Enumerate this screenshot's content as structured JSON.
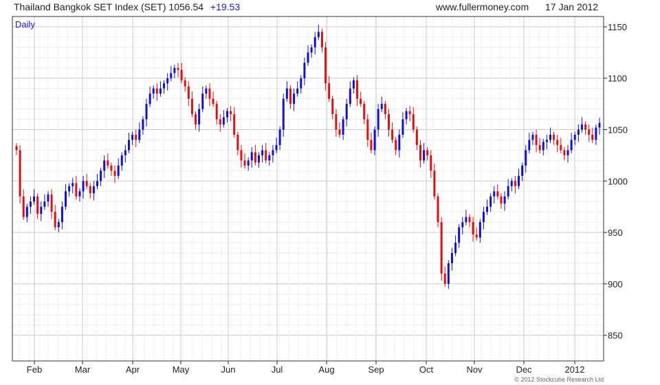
{
  "header": {
    "title": "Thailand Bangkok SET Index (SET)",
    "last": "1056.54",
    "change": "+19.53",
    "site": "www.fullermoney.com",
    "date": "17 Jan 2012"
  },
  "period_label": "Daily",
  "copyright": "© 2012 Stockcube Research Ltd",
  "colors": {
    "up": "#1010d8",
    "down": "#e01010",
    "grid": "#dcdcdc",
    "axis": "#222222"
  },
  "chart_data": {
    "type": "candlestick",
    "ylim": [
      825,
      1160
    ],
    "y_ticks": [
      850,
      900,
      950,
      1000,
      1050,
      1100,
      1150
    ],
    "x_ticks": [
      "Feb",
      "Mar",
      "Apr",
      "May",
      "Jun",
      "Jul",
      "Aug",
      "Sep",
      "Oct",
      "Nov",
      "Dec",
      "2012"
    ],
    "grid": true,
    "series_close": [
      1030,
      985,
      965,
      975,
      980,
      985,
      968,
      975,
      980,
      987,
      970,
      955,
      960,
      975,
      990,
      995,
      998,
      985,
      990,
      1000,
      995,
      988,
      995,
      1000,
      1010,
      1020,
      1015,
      1010,
      1005,
      1015,
      1025,
      1030,
      1040,
      1045,
      1040,
      1050,
      1060,
      1075,
      1085,
      1090,
      1085,
      1090,
      1095,
      1100,
      1105,
      1110,
      1108,
      1098,
      1092,
      1080,
      1065,
      1055,
      1070,
      1085,
      1090,
      1080,
      1075,
      1060,
      1055,
      1062,
      1068,
      1065,
      1045,
      1030,
      1020,
      1015,
      1020,
      1028,
      1018,
      1025,
      1030,
      1020,
      1025,
      1030,
      1035,
      1050,
      1080,
      1090,
      1075,
      1085,
      1090,
      1100,
      1115,
      1125,
      1130,
      1140,
      1145,
      1130,
      1095,
      1080,
      1065,
      1050,
      1045,
      1060,
      1075,
      1090,
      1098,
      1080,
      1075,
      1060,
      1040,
      1030,
      1050,
      1070,
      1075,
      1065,
      1050,
      1040,
      1030,
      1045,
      1060,
      1068,
      1065,
      1050,
      1035,
      1020,
      1030,
      1025,
      1010,
      985,
      960,
      910,
      900,
      920,
      930,
      940,
      955,
      960,
      965,
      960,
      948,
      945,
      960,
      970,
      975,
      985,
      990,
      985,
      978,
      985,
      995,
      1000,
      995,
      1005,
      1015,
      1030,
      1040,
      1045,
      1035,
      1030,
      1038,
      1040,
      1045,
      1040,
      1035,
      1030,
      1025,
      1030,
      1040,
      1045,
      1050,
      1055,
      1050,
      1045,
      1040,
      1052,
      1056.54
    ],
    "legend": "none"
  }
}
